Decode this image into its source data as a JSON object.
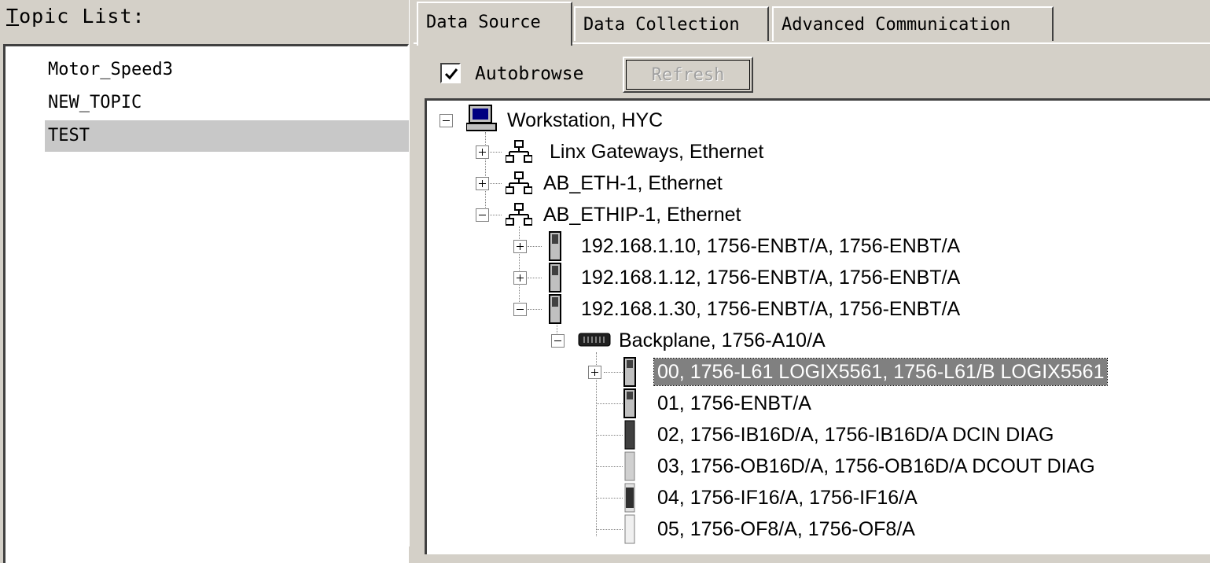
{
  "topic_panel": {
    "label_accel": "T",
    "label_rest": "opic List:",
    "items": [
      "Motor_Speed3",
      "NEW_TOPIC",
      "TEST"
    ],
    "selected": "TEST"
  },
  "tabs": [
    "Data Source",
    "Data Collection",
    "Advanced Communication"
  ],
  "active_tab": "Data Source",
  "toolbar": {
    "autobrowse_label": "Autobrowse",
    "autobrowse_checked": true,
    "refresh_label": "Refresh"
  },
  "tree": {
    "workstation": "Workstation, HYC",
    "linx_gateways": "Linx Gateways, Ethernet",
    "ab_eth": "AB_ETH-1, Ethernet",
    "ab_ethip": "AB_ETHIP-1, Ethernet",
    "host_10": "192.168.1.10, 1756-ENBT/A, 1756-ENBT/A",
    "host_12": "192.168.1.12, 1756-ENBT/A, 1756-ENBT/A",
    "host_30": "192.168.1.30, 1756-ENBT/A, 1756-ENBT/A",
    "backplane": "Backplane, 1756-A10/A",
    "slots": [
      "00, 1756-L61 LOGIX5561, 1756-L61/B LOGIX5561",
      "01, 1756-ENBT/A",
      "02, 1756-IB16D/A, 1756-IB16D/A  DCIN  DIAG",
      "03, 1756-OB16D/A, 1756-OB16D/A  DCOUT DIAG",
      "04, 1756-IF16/A, 1756-IF16/A",
      "05, 1756-OF8/A, 1756-OF8/A"
    ],
    "selected_slot": 0
  }
}
